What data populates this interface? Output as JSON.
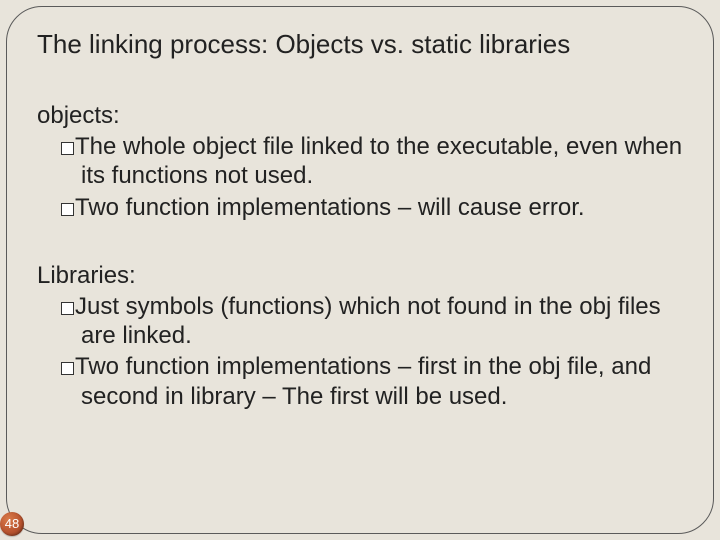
{
  "title": "The linking process: Objects vs. static libraries",
  "sections": [
    {
      "label": "objects:",
      "bullets": [
        "The whole object file linked to the executable, even when its functions not used.",
        "Two function implementations – will cause error."
      ]
    },
    {
      "label": "Libraries:",
      "bullets": [
        "Just symbols (functions) which not found in the obj files are linked.",
        "Two function implementations – first in the obj file, and second in library – The first will be used."
      ]
    }
  ],
  "page_number": "48"
}
